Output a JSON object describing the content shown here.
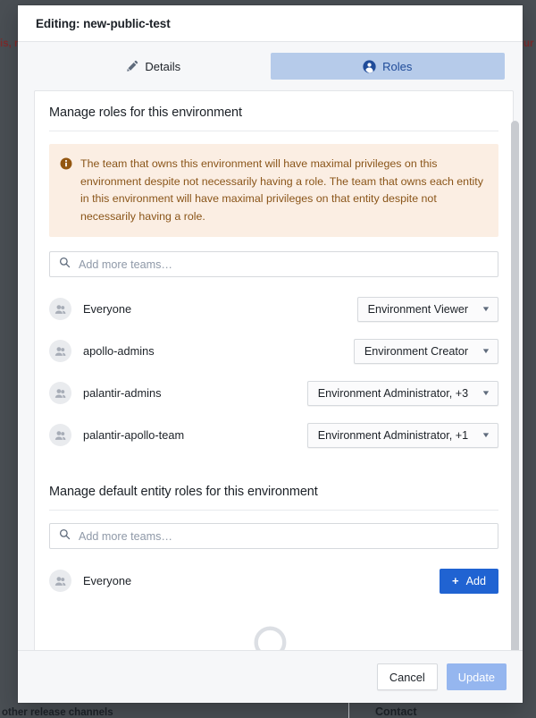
{
  "background": {
    "left_text": "is, no",
    "right_text": "ur",
    "bottom_left_text": "other release channels",
    "bottom_right_text": "Contact"
  },
  "modal": {
    "title": "Editing: new-public-test",
    "tabs": [
      {
        "label": "Details",
        "icon": "pencil-icon",
        "active": false
      },
      {
        "label": "Roles",
        "icon": "user-circle-icon",
        "active": true
      }
    ],
    "roles_section": {
      "title": "Manage roles for this environment",
      "callout": {
        "icon": "info-sign-icon",
        "text": "The team that owns this environment will have maximal privileges on this environment despite not necessarily having a role. The team that owns each entity in this environment will have maximal privileges on that entity despite not necessarily having a role."
      },
      "search_placeholder": "Add more teams…",
      "teams": [
        {
          "name": "Everyone",
          "role": "Environment Viewer"
        },
        {
          "name": "apollo-admins",
          "role": "Environment Creator"
        },
        {
          "name": "palantir-admins",
          "role": "Environment Administrator, +3"
        },
        {
          "name": "palantir-apollo-team",
          "role": "Environment Administrator, +1"
        }
      ]
    },
    "default_entity_section": {
      "title": "Manage default entity roles for this environment",
      "search_placeholder": "Add more teams…",
      "teams": [
        {
          "name": "Everyone",
          "add_label": "Add"
        }
      ],
      "empty_state_icon": "search-icon"
    },
    "footer": {
      "cancel_label": "Cancel",
      "update_label": "Update"
    }
  },
  "colors": {
    "accent_blue": "#2063d2",
    "tab_active_bg": "#b6cbea",
    "tab_active_text": "#1f4b99",
    "callout_bg": "#fbeee3",
    "callout_text": "#8a5519",
    "disabled_primary": "#95b6ef"
  }
}
